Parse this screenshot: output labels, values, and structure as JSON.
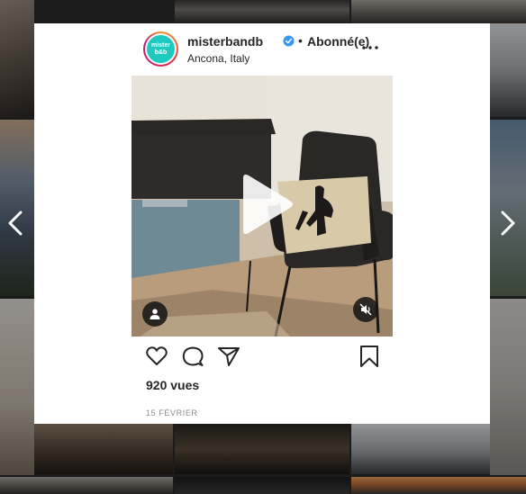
{
  "post": {
    "username": "misterbandb",
    "follow_state": "Abonné(e)",
    "location": "Ancona, Italy",
    "avatar_text": "mister b&b",
    "views": "920 vues",
    "date": "15 FÉVRIER"
  },
  "icons": {
    "verified": "verified-badge-icon",
    "more": "more-options-icon",
    "play": "play-icon",
    "user_tag": "user-tag-icon",
    "mute": "muted-speaker-icon",
    "like": "heart-icon",
    "comment": "comment-icon",
    "share": "paper-plane-icon",
    "save": "bookmark-icon",
    "prev": "chevron-left-icon",
    "next": "chevron-right-icon"
  },
  "colors": {
    "verified_blue": "#3897f0",
    "avatar_teal": "#1ec9c0",
    "text_primary": "#262626",
    "text_secondary": "#8e8e8e"
  }
}
